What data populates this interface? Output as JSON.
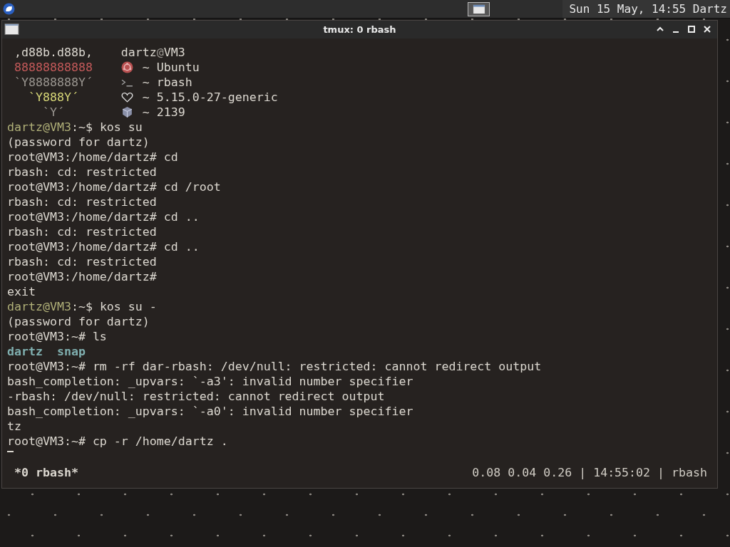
{
  "panel": {
    "clock": "Sun 15 May, 14:55 Dartz"
  },
  "window": {
    "title": "tmux: 0 rbash"
  },
  "neofetch": {
    "header": {
      "logo": " ,d88b.d88b,",
      "color": "#dcd8d0",
      "user": "dartz",
      "at": "@",
      "host": "VM3"
    },
    "rows": [
      {
        "logo": " 88888888888",
        "color": "#c45a5a",
        "kind": "ubuntu",
        "text": "~ Ubuntu"
      },
      {
        "logo": " `Y8888888Y´",
        "color": "#9a9690",
        "kind": "shell",
        "text": "~ rbash"
      },
      {
        "logo": "   `Y888Y´",
        "color": "#d8d878",
        "kind": "kernel",
        "text": "~ 5.15.0-27-generic"
      },
      {
        "logo": "     `Y´",
        "color": "#9a9690",
        "kind": "packages",
        "text": "~ 2139"
      }
    ]
  },
  "lines": [
    {
      "segments": [
        {
          "text": "dartz@VM3",
          "kind": "user"
        },
        {
          "text": ":~$ kos su",
          "kind": "plain"
        }
      ]
    },
    {
      "segments": [
        {
          "text": "(password for dartz)",
          "kind": "plain"
        }
      ]
    },
    {
      "segments": [
        {
          "text": "root@VM3:/home/dartz# cd",
          "kind": "plain"
        }
      ]
    },
    {
      "segments": [
        {
          "text": "rbash: cd: restricted",
          "kind": "plain"
        }
      ]
    },
    {
      "segments": [
        {
          "text": "root@VM3:/home/dartz# cd /root",
          "kind": "plain"
        }
      ]
    },
    {
      "segments": [
        {
          "text": "rbash: cd: restricted",
          "kind": "plain"
        }
      ]
    },
    {
      "segments": [
        {
          "text": "root@VM3:/home/dartz# cd ..",
          "kind": "plain"
        }
      ]
    },
    {
      "segments": [
        {
          "text": "rbash: cd: restricted",
          "kind": "plain"
        }
      ]
    },
    {
      "segments": [
        {
          "text": "root@VM3:/home/dartz# cd ..",
          "kind": "plain"
        }
      ]
    },
    {
      "segments": [
        {
          "text": "rbash: cd: restricted",
          "kind": "plain"
        }
      ]
    },
    {
      "segments": [
        {
          "text": "root@VM3:/home/dartz#",
          "kind": "plain"
        }
      ]
    },
    {
      "segments": [
        {
          "text": "exit",
          "kind": "plain"
        }
      ]
    },
    {
      "segments": [
        {
          "text": "dartz@VM3",
          "kind": "user"
        },
        {
          "text": ":~$ kos su -",
          "kind": "plain"
        }
      ]
    },
    {
      "segments": [
        {
          "text": "(password for dartz)",
          "kind": "plain"
        }
      ]
    },
    {
      "segments": [
        {
          "text": "root@VM3:~# ls",
          "kind": "plain"
        }
      ]
    },
    {
      "segments": [
        {
          "text": "dartz  snap",
          "kind": "dir"
        }
      ]
    },
    {
      "segments": [
        {
          "text": "root@VM3:~# rm -rf dar-rbash: /dev/null: restricted: cannot redirect output",
          "kind": "plain"
        }
      ]
    },
    {
      "segments": [
        {
          "text": "bash_completion: _upvars: `-a3': invalid number specifier",
          "kind": "plain"
        }
      ]
    },
    {
      "segments": [
        {
          "text": "-rbash: /dev/null: restricted: cannot redirect output",
          "kind": "plain"
        }
      ]
    },
    {
      "segments": [
        {
          "text": "bash_completion: _upvars: `-a0': invalid number specifier",
          "kind": "plain"
        }
      ]
    },
    {
      "segments": [
        {
          "text": "tz",
          "kind": "plain"
        }
      ]
    },
    {
      "segments": [
        {
          "text": "root@VM3:~# cp -r /home/dartz .",
          "kind": "plain"
        }
      ]
    }
  ],
  "cursor": {
    "visible": true
  },
  "status_bar": {
    "left": "*0 rbash*",
    "right": "0.08 0.04 0.26 | 14:55:02 | rbash"
  }
}
